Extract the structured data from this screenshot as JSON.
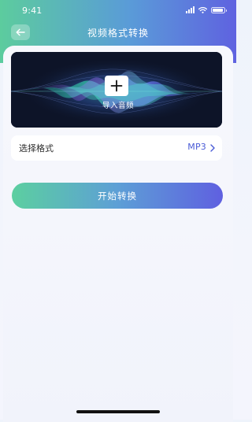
{
  "status_bar": {
    "time": "9:41"
  },
  "header": {
    "title": "视频格式转换",
    "back_icon": "arrow-left-icon"
  },
  "import_area": {
    "label": "导入音频",
    "icon": "plus-icon"
  },
  "format_row": {
    "label": "选择格式",
    "value": "MP3",
    "icon": "chevron-right-icon"
  },
  "start_button": {
    "label": "开始转换"
  },
  "colors": {
    "header_gradient": [
      "#5ccc9e",
      "#5a9bd8",
      "#5f62e0"
    ],
    "accent_text": "#4a5bd6",
    "import_bg": "#0d1428"
  }
}
